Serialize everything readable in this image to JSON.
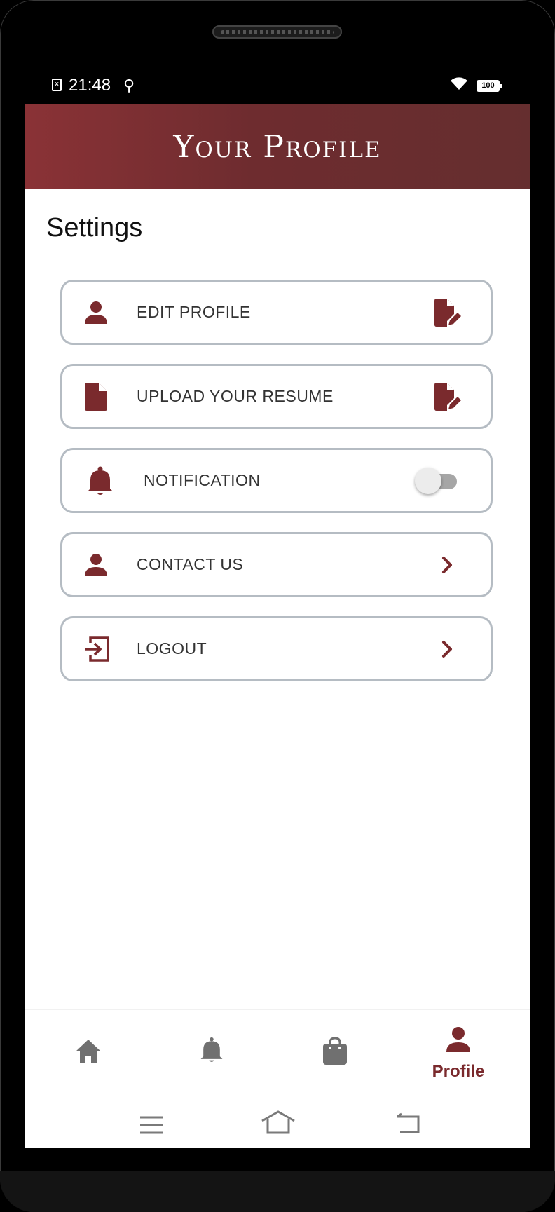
{
  "status_bar": {
    "time": "21:48",
    "battery": "100",
    "sim_icon": "sim-missing-icon",
    "usb_icon": "usb-icon",
    "wifi_icon": "wifi-icon"
  },
  "header": {
    "title": "Your Profile"
  },
  "settings": {
    "title": "Settings",
    "items": [
      {
        "label": "EDIT PROFILE",
        "icon": "person-icon",
        "trailing": "edit-document-icon"
      },
      {
        "label": "UPLOAD YOUR RESUME",
        "icon": "document-icon",
        "trailing": "edit-document-icon"
      },
      {
        "label": "NOTIFICATION",
        "icon": "bell-icon",
        "trailing": "toggle",
        "toggle_on": false
      },
      {
        "label": "CONTACT US",
        "icon": "person-icon",
        "trailing": "chevron-right-icon"
      },
      {
        "label": "LOGOUT",
        "icon": "logout-icon",
        "trailing": "chevron-right-icon"
      }
    ]
  },
  "bottom_nav": {
    "items": [
      {
        "icon": "home-icon",
        "label": "",
        "active": false
      },
      {
        "icon": "bell-icon",
        "label": "",
        "active": false
      },
      {
        "icon": "shopping-bag-icon",
        "label": "",
        "active": false
      },
      {
        "icon": "person-icon",
        "label": "Profile",
        "active": true
      }
    ]
  },
  "colors": {
    "accent": "#7a2a2d",
    "header_start": "#8a3236",
    "header_end": "#652e2f",
    "inactive_icon": "#707070",
    "card_border": "#b5bcc3"
  }
}
